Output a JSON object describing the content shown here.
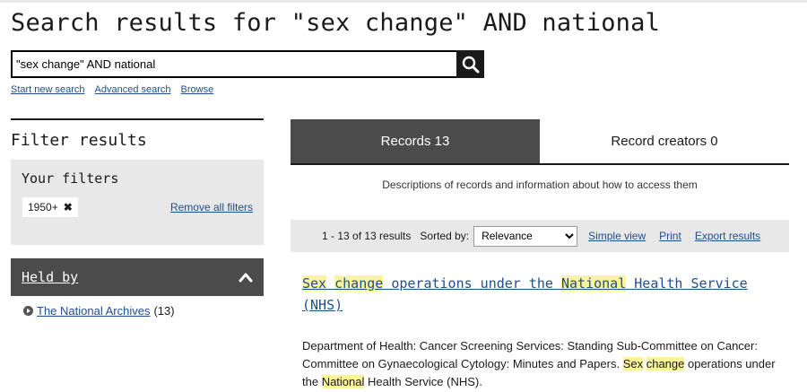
{
  "page": {
    "title": "Search results for \"sex change\" AND national"
  },
  "search": {
    "value": "\"sex change\" AND national",
    "links": [
      "Start new search",
      "Advanced search",
      "Browse"
    ]
  },
  "filters": {
    "heading": "Filter results",
    "your_filters_heading": "Your filters",
    "active_filter": "1950+",
    "remove_all": "Remove all filters"
  },
  "held_by": {
    "heading": "Held by",
    "item_label": "The National Archives",
    "item_count": "(13)"
  },
  "tabs": {
    "records": "Records 13",
    "creators": "Record creators 0",
    "description": "Descriptions of records and information about how to access them"
  },
  "results_bar": {
    "count": "1 - 13 of 13 results",
    "sorted_by": "Sorted by:",
    "sort_value": "Relevance",
    "simple_view": "Simple view",
    "print": "Print",
    "export": "Export results"
  },
  "result": {
    "title_parts": [
      "Sex",
      " ",
      "change",
      " operations under the ",
      "National",
      " Health Service (NHS)"
    ],
    "desc_prefix": "Department of Health: Cancer Screening Services: Standing Sub-Committee on Cancer: Committee on Gynaecological Cytology: Minutes and Papers. ",
    "desc_hl1": "Sex",
    "desc_hl2": "change",
    "desc_mid": " operations under the ",
    "desc_hl3": "National",
    "desc_suffix": " Health Service (NHS)."
  },
  "colors": {
    "link": "#1f4e8c",
    "highlight": "#fcf49a",
    "dark_panel": "#4b4b4b",
    "light_panel": "#e8e8e8"
  },
  "icons": {
    "search": "search-icon",
    "close": "close-icon",
    "chevron": "chevron-up-icon",
    "bullet": "circle-arrow-icon"
  }
}
